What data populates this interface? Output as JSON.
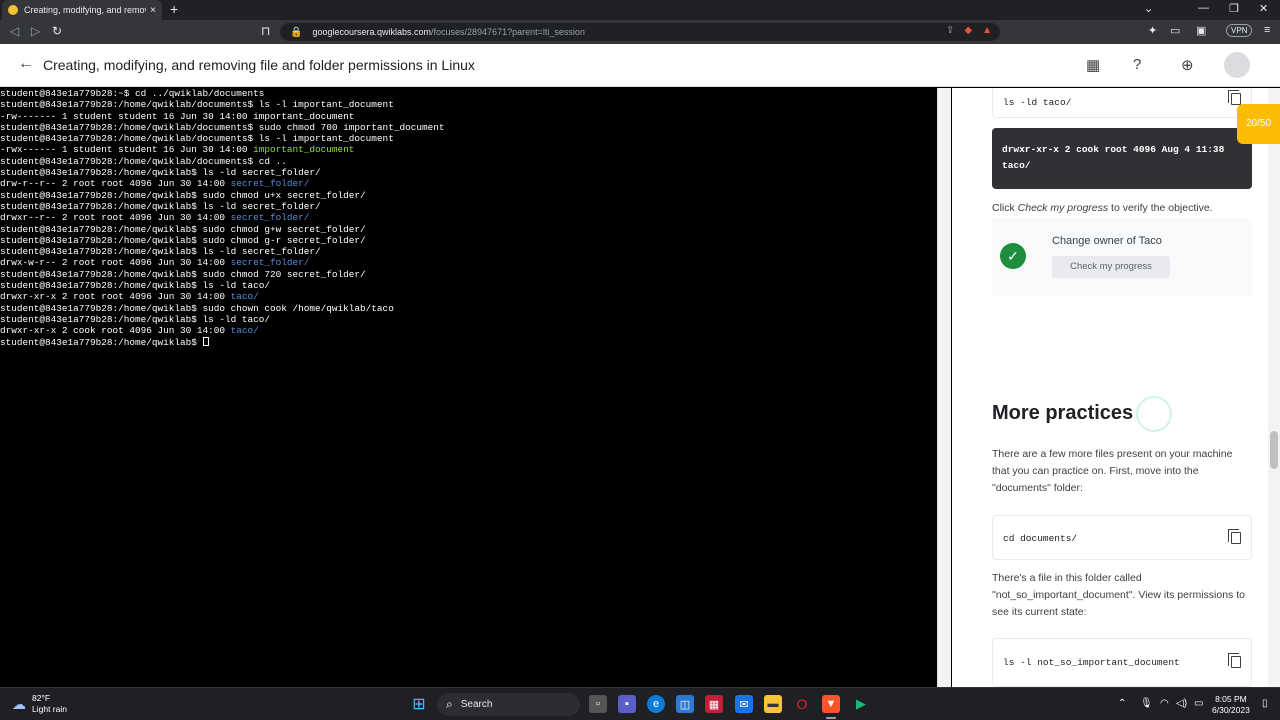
{
  "browser": {
    "tab_title": "Creating, modifying, and removin",
    "new_tab_symbol": "+",
    "close_symbol": "×",
    "url_host": "googlecoursera.qwiklabs.com",
    "url_path": "/focuses/28947671?parent=lti_session",
    "vpn_label": "VPN"
  },
  "lab": {
    "title": "Creating, modifying, and removing file and folder permissions in Linux",
    "progress": "20/50"
  },
  "terminal": {
    "lines": [
      [
        {
          "t": "student@843e1a779b28:~$ cd ../qwiklab/documents"
        }
      ],
      [
        {
          "t": "student@843e1a779b28:/home/qwiklab/documents$ ls -l important_document"
        }
      ],
      [
        {
          "t": "-rw------- 1 student student 16 Jun 30 14:00 important_document"
        }
      ],
      [
        {
          "t": "student@843e1a779b28:/home/qwiklab/documents$ sudo chmod 700 important_document"
        }
      ],
      [
        {
          "t": "student@843e1a779b28:/home/qwiklab/documents$ ls -l important_document"
        }
      ],
      [
        {
          "t": "-rwx------ 1 student student 16 Jun 30 14:00 "
        },
        {
          "t": "important_document",
          "c": "green"
        }
      ],
      [
        {
          "t": "student@843e1a779b28:/home/qwiklab/documents$ cd .."
        }
      ],
      [
        {
          "t": "student@843e1a779b28:/home/qwiklab$ ls -ld secret_folder/"
        }
      ],
      [
        {
          "t": "drw-r--r-- 2 root root 4096 Jun 30 14:00 "
        },
        {
          "t": "secret_folder/",
          "c": "blue"
        }
      ],
      [
        {
          "t": "student@843e1a779b28:/home/qwiklab$ sudo chmod u+x secret_folder/"
        }
      ],
      [
        {
          "t": "student@843e1a779b28:/home/qwiklab$ ls -ld secret_folder/"
        }
      ],
      [
        {
          "t": "drwxr--r-- 2 root root 4096 Jun 30 14:00 "
        },
        {
          "t": "secret_folder/",
          "c": "blue"
        }
      ],
      [
        {
          "t": "student@843e1a779b28:/home/qwiklab$ sudo chmod g+w secret_folder/"
        }
      ],
      [
        {
          "t": "student@843e1a779b28:/home/qwiklab$ sudo chmod g-r secret_folder/"
        }
      ],
      [
        {
          "t": "student@843e1a779b28:/home/qwiklab$ ls -ld secret_folder/"
        }
      ],
      [
        {
          "t": "drwx-w-r-- 2 root root 4096 Jun 30 14:00 "
        },
        {
          "t": "secret_folder/",
          "c": "blue"
        }
      ],
      [
        {
          "t": "student@843e1a779b28:/home/qwiklab$ sudo chmod 720 secret_folder/"
        }
      ],
      [
        {
          "t": "student@843e1a779b28:/home/qwiklab$ ls -ld taco/"
        }
      ],
      [
        {
          "t": "drwxr-xr-x 2 root root 4096 Jun 30 14:00 "
        },
        {
          "t": "taco/",
          "c": "blue"
        }
      ],
      [
        {
          "t": "student@843e1a779b28:/home/qwiklab$ sudo chown cook /home/qwiklab/taco"
        }
      ],
      [
        {
          "t": "student@843e1a779b28:/home/qwiklab$ ls -ld taco/"
        }
      ],
      [
        {
          "t": "drwxr-xr-x 2 cook root 4096 Jun 30 14:00 "
        },
        {
          "t": "taco/",
          "c": "blue"
        }
      ],
      [
        {
          "t": "student@843e1a779b28:/home/qwiklab$ "
        },
        {
          "cursor": true
        }
      ]
    ]
  },
  "panel": {
    "code1": "ls -ld taco/",
    "output_line1": "drwxr-xr-x 2 cook root 4096 Aug  4 11:38",
    "output_line2": "taco/",
    "check_pre": "Click ",
    "check_em": "Check my progress",
    "check_post": " to verify the objective.",
    "objective_title": "Change owner of Taco",
    "check_button": "Check my progress",
    "heading": "More practices",
    "para1": "There are a few more files present on your machine that you can practice on. First, move into the \"documents\" folder:",
    "code2": "cd documents/",
    "para2": "There's a file in this folder called \"not_so_important_document\". View its permissions to see its current state:",
    "code3": "ls -l not_so_important_document"
  },
  "taskbar": {
    "temperature": "82°F",
    "condition": "Light rain",
    "search_label": "Search",
    "time": "8:05 PM",
    "date": "6/30/2023"
  }
}
